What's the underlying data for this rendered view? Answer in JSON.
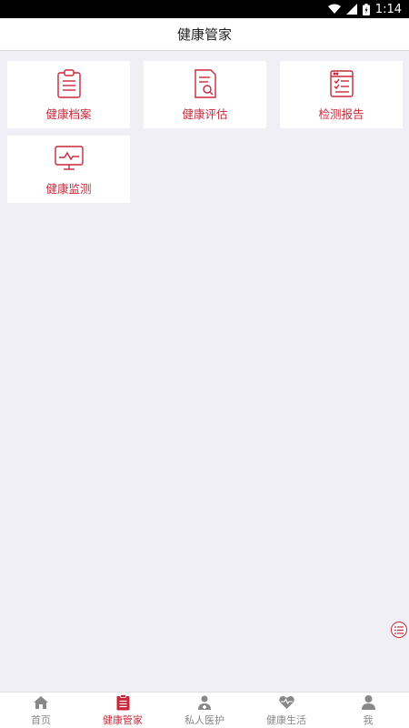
{
  "status_bar": {
    "time": "1:14"
  },
  "header": {
    "title": "健康管家"
  },
  "tiles": [
    {
      "label": "健康档案",
      "icon": "clipboard-icon"
    },
    {
      "label": "健康评估",
      "icon": "document-search-icon"
    },
    {
      "label": "检测报告",
      "icon": "report-checklist-icon"
    },
    {
      "label": "健康监测",
      "icon": "monitor-pulse-icon"
    }
  ],
  "tab_bar": {
    "items": [
      {
        "label": "首页",
        "icon": "home-icon"
      },
      {
        "label": "健康管家",
        "icon": "clipboard-icon",
        "active": true
      },
      {
        "label": "私人医护",
        "icon": "doctor-icon"
      },
      {
        "label": "健康生活",
        "icon": "heart-pulse-icon"
      },
      {
        "label": "我",
        "icon": "user-icon"
      }
    ]
  },
  "colors": {
    "accent": "#c9283a",
    "background": "#efeff5",
    "inactive": "#888888"
  }
}
